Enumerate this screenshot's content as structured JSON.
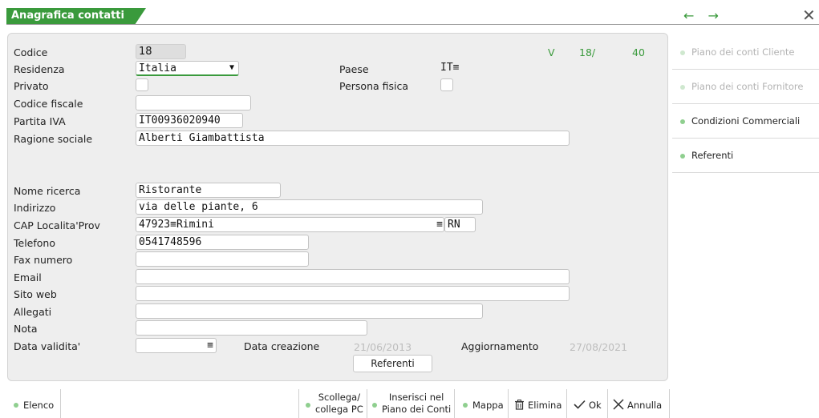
{
  "window": {
    "title": "Anagrafica contatti",
    "nav_arrows": "← →",
    "close_symbol": "✕"
  },
  "form": {
    "codice": {
      "label": "Codice",
      "value": "18"
    },
    "version": {
      "prefix": "V",
      "number": "18/",
      "count": "40"
    },
    "residenza": {
      "label": "Residenza",
      "value": "Italia"
    },
    "paese": {
      "label": "Paese",
      "value": "IT"
    },
    "privato": {
      "label": "Privato"
    },
    "persona_fisica": {
      "label": "Persona fisica"
    },
    "codice_fiscale": {
      "label": "Codice fiscale",
      "value": ""
    },
    "partita_iva": {
      "label": "Partita IVA",
      "value": "IT00936020940"
    },
    "ragione_sociale": {
      "label": "Ragione sociale",
      "value": "Alberti Giambattista"
    },
    "nome_ricerca": {
      "label": "Nome ricerca",
      "value": "Ristorante"
    },
    "indirizzo": {
      "label": "Indirizzo",
      "value": "via delle piante, 6"
    },
    "cap": {
      "label": "CAP Localita'Prov",
      "cap_value": "47923",
      "localita_value": "Rimini",
      "prov_value": "RN"
    },
    "telefono": {
      "label": "Telefono",
      "value": "0541748596"
    },
    "fax": {
      "label": "Fax numero",
      "value": ""
    },
    "email": {
      "label": "Email",
      "value": ""
    },
    "sito_web": {
      "label": "Sito web",
      "value": ""
    },
    "allegati": {
      "label": "Allegati",
      "value": ""
    },
    "nota": {
      "label": "Nota",
      "value": ""
    },
    "data_validita": {
      "label": "Data validita'",
      "value": ""
    },
    "data_creazione": {
      "label": "Data creazione",
      "value": "21/06/2013"
    },
    "aggiornamento": {
      "label": "Aggiornamento",
      "value": "27/08/2021"
    },
    "referenti_button": "Referenti"
  },
  "sidebar": {
    "items": [
      {
        "label": "Piano dei conti Cliente",
        "enabled": false
      },
      {
        "label": "Piano dei conti Fornitore",
        "enabled": false
      },
      {
        "label": "Condizioni Commerciali",
        "enabled": true
      },
      {
        "label": "Referenti",
        "enabled": true
      }
    ]
  },
  "bottom_bar": {
    "elenco": "Elenco",
    "scollega_line1": "Scollega/",
    "scollega_line2": "collega PC",
    "inserisci_line1": "Inserisci nel",
    "inserisci_line2": "Piano dei Conti",
    "mappa": "Mappa",
    "elimina": "Elimina",
    "ok": "Ok",
    "annulla": "Annulla"
  },
  "colors": {
    "accent": "#3a9a3c",
    "panel": "#eeeeee"
  }
}
